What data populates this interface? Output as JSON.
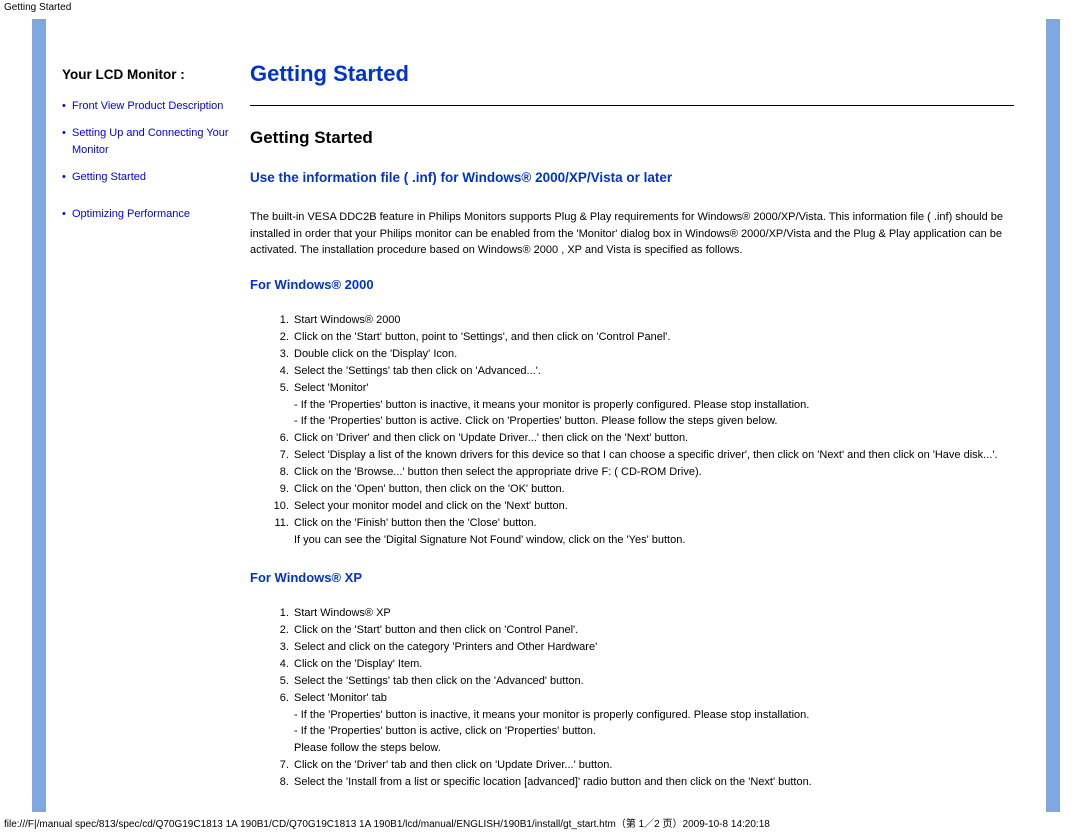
{
  "topLabel": "Getting Started",
  "sidebar": {
    "heading": "Your LCD Monitor :",
    "items": [
      {
        "label": "Front View Product Description"
      },
      {
        "label": "Setting Up and Connecting Your Monitor"
      },
      {
        "label": "Getting Started"
      },
      {
        "label": "Optimizing Performance"
      }
    ]
  },
  "main": {
    "title": "Getting Started",
    "subtitle": "Getting Started",
    "instructionHeading": "Use the information file ( .inf) for Windows® 2000/XP/Vista or later",
    "intro": "The built-in VESA DDC2B feature in Philips Monitors supports Plug & Play requirements for Windows® 2000/XP/Vista. This information file ( .inf) should be installed in order that your Philips monitor can be enabled from the 'Monitor' dialog box in Windows® 2000/XP/Vista and the Plug & Play application can be activated. The installation procedure based on Windows® 2000 , XP and Vista is specified as follows.",
    "sections": [
      {
        "heading": "For Windows® 2000",
        "steps": [
          "Start Windows® 2000",
          "Click on the 'Start' button, point to 'Settings', and then click on 'Control Panel'.",
          "Double click on the 'Display' Icon.",
          "Select the 'Settings' tab then click on 'Advanced...'.",
          "Select 'Monitor'\n- If the 'Properties' button is inactive, it means your monitor is properly configured. Please stop installation.\n- If the 'Properties' button is active. Click on 'Properties' button. Please follow the steps given below.",
          "Click on 'Driver' and then click on 'Update Driver...' then click on the 'Next' button.",
          "Select 'Display a list of the known drivers for this device so that I can choose a specific driver', then click on 'Next' and then click on 'Have disk...'.",
          "Click on the 'Browse...' button then select the appropriate drive F: ( CD-ROM Drive).",
          "Click on the 'Open' button, then click on the 'OK' button.",
          "Select your monitor model and click on the 'Next' button.",
          "Click on the 'Finish' button then the 'Close' button.\nIf you can see the 'Digital Signature Not Found' window, click on the 'Yes' button."
        ]
      },
      {
        "heading": "For Windows® XP",
        "steps": [
          "Start Windows® XP",
          "Click on the 'Start' button and then click on 'Control Panel'.",
          "Select and click on the category 'Printers and Other Hardware'",
          "Click on the 'Display' Item.",
          "Select the 'Settings' tab then click on the 'Advanced' button.",
          "Select 'Monitor' tab\n- If the 'Properties' button is inactive, it means your monitor is properly configured. Please stop installation.\n- If the 'Properties' button is active, click on 'Properties' button.\nPlease follow the steps below.",
          "Click on the 'Driver' tab and then click on 'Update Driver...' button.",
          "Select the 'Install from a list or specific location [advanced]' radio button and then click on the 'Next' button."
        ]
      }
    ]
  },
  "footer": "file:///F|/manual spec/813/spec/cd/Q70G19C1813 1A 190B1/CD/Q70G19C1813 1A 190B1/lcd/manual/ENGLISH/190B1/install/gt_start.htm（第 1／2 页）2009-10-8 14:20:18"
}
